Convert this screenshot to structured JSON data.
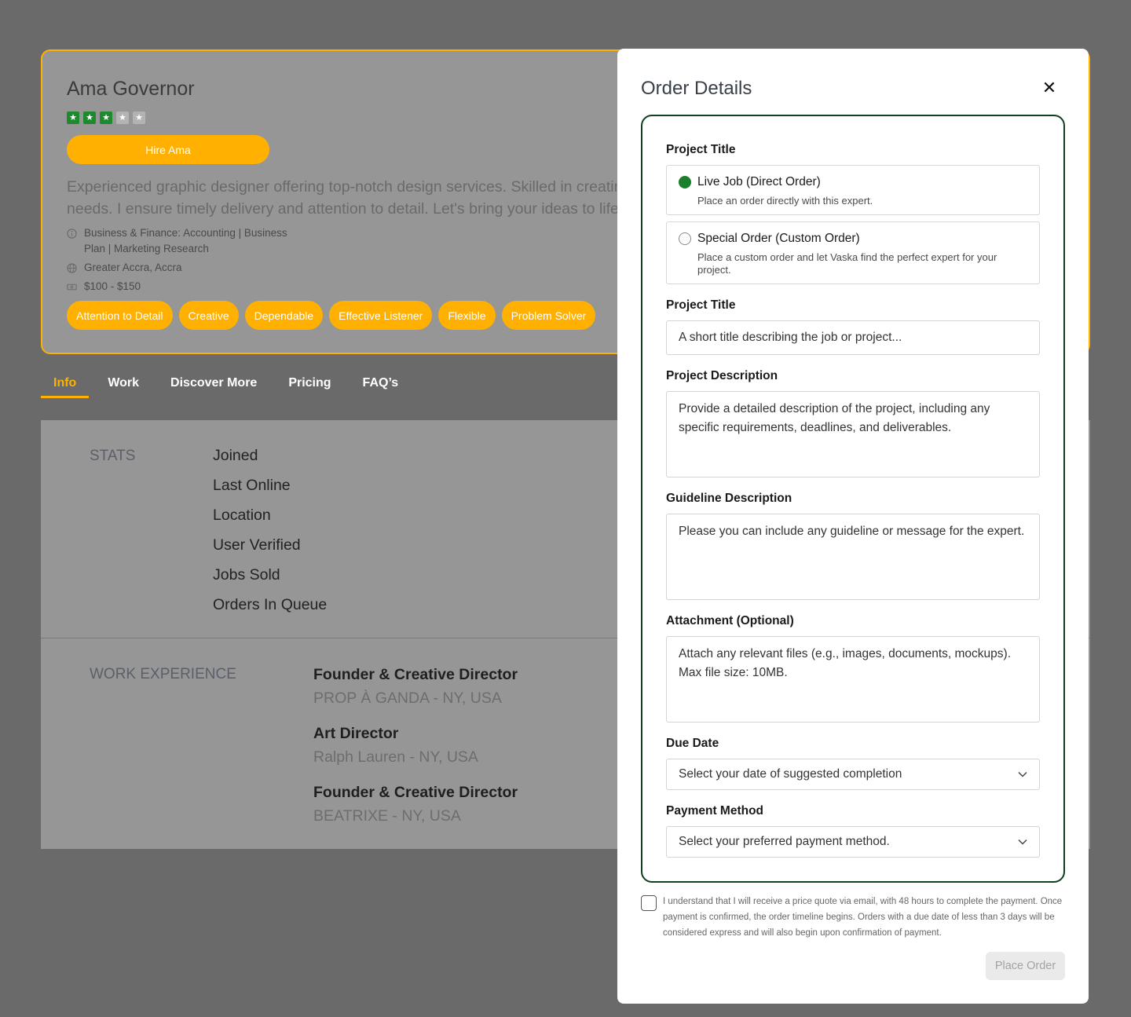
{
  "profile": {
    "name": "Ama Governor",
    "rating": 3,
    "rating_max": 5,
    "hire_label": "Hire Ama",
    "bio": "Experienced graphic designer offering top-notch design services. Skilled in creating visually appealing designs tailored to your needs. I ensure timely delivery and attention to detail. Let's bring your ideas to life on schedule.",
    "category": "Business & Finance: Accounting | Business Plan | Marketing Research",
    "location": "Greater Accra, Accra",
    "price_range": "$100 - $150",
    "tags": [
      "Attention to Detail",
      "Creative",
      "Dependable",
      "Effective Listener",
      "Flexible",
      "Problem Solver"
    ]
  },
  "tabs": [
    "Info",
    "Work",
    "Discover More",
    "Pricing",
    "FAQ’s"
  ],
  "active_tab": 0,
  "stats": {
    "label": "STATS",
    "items": [
      "Joined",
      "Last Online",
      "Location",
      "User Verified",
      "Jobs Sold",
      "Orders In Queue"
    ]
  },
  "work_experience": {
    "label": "WORK EXPERIENCE",
    "items": [
      {
        "title": "Founder & Creative Director",
        "company": "PROP À GANDA - NY, USA"
      },
      {
        "title": "Art Director",
        "company": "Ralph Lauren - NY, USA"
      },
      {
        "title": "Founder & Creative Director",
        "company": "BEATRIXE - NY, USA"
      }
    ]
  },
  "modal": {
    "title": "Order Details",
    "close_icon": "close-icon",
    "order_type_label": "Project Title",
    "options": [
      {
        "title": "Live Job (Direct Order)",
        "desc": "Place an order directly with this expert.",
        "checked": true
      },
      {
        "title": "Special Order (Custom Order)",
        "desc": "Place a custom order and let Vaska find the perfect expert for your project.",
        "checked": false
      }
    ],
    "project_title_label": "Project Title",
    "project_title_placeholder": "A short title describing the job or project...",
    "description_label": "Project Description",
    "description_placeholder": "Provide a detailed description of the project, including any specific requirements, deadlines, and deliverables.",
    "guideline_label": "Guideline Description",
    "guideline_placeholder": "Please you can include any guideline or message for the expert.",
    "attachment_label": "Attachment (Optional)",
    "attachment_placeholder": "Attach any relevant files (e.g., images, documents, mockups). Max file size: 10MB.",
    "due_date_label": "Due Date",
    "due_date_placeholder": "Select your date of suggested completion",
    "payment_label": "Payment Method",
    "payment_placeholder": "Select your preferred payment method.",
    "consent_text": "I understand that I will receive a price quote via email, with 48 hours to complete the payment. Once payment is confirmed, the order timeline begins. Orders with a due date of less than 3 days will be considered express and will also begin upon confirmation of payment.",
    "place_order_label": "Place Order"
  },
  "colors": {
    "accent": "#ffb000",
    "success": "#1a7f2a",
    "form_border": "#0f3f1f"
  }
}
